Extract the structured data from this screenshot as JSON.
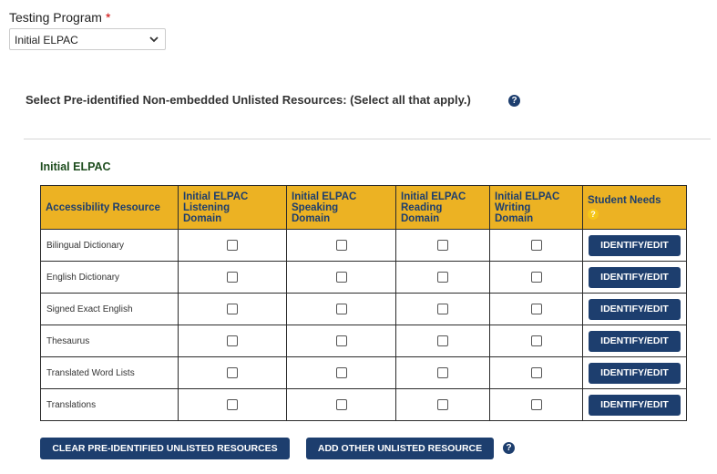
{
  "testing_program": {
    "label": "Testing Program",
    "required_mark": "*",
    "selected": "Initial ELPAC"
  },
  "prompt": "Select Pre-identified Non-embedded Unlisted Resources: (Select all that apply.)",
  "section_title": "Initial ELPAC",
  "table": {
    "headers": {
      "resource": "Accessibility Resource",
      "listening": [
        "Initial ELPAC",
        "Listening",
        "Domain"
      ],
      "speaking": [
        "Initial ELPAC",
        "Speaking",
        "Domain"
      ],
      "reading": [
        "Initial ELPAC",
        "Reading",
        "Domain"
      ],
      "writing": [
        "Initial ELPAC",
        "Writing",
        "Domain"
      ],
      "needs": "Student Needs"
    },
    "rows": [
      {
        "name": "Bilingual Dictionary",
        "action": "IDENTIFY/EDIT"
      },
      {
        "name": "English Dictionary",
        "action": "IDENTIFY/EDIT"
      },
      {
        "name": "Signed Exact English",
        "action": "IDENTIFY/EDIT"
      },
      {
        "name": "Thesaurus",
        "action": "IDENTIFY/EDIT"
      },
      {
        "name": "Translated Word Lists",
        "action": "IDENTIFY/EDIT"
      },
      {
        "name": "Translations",
        "action": "IDENTIFY/EDIT"
      }
    ]
  },
  "buttons": {
    "clear": "CLEAR PRE-IDENTIFIED UNLISTED RESOURCES",
    "add": "ADD OTHER UNLISTED RESOURCE"
  },
  "help_glyph": "?",
  "icons": {
    "help": "question-circle-icon",
    "dropdown": "chevron-down-icon"
  },
  "colors": {
    "header_bg": "#ecb223",
    "button_bg": "#1d3e6e",
    "section_title": "#1e4d1e",
    "required": "#cc0000"
  }
}
